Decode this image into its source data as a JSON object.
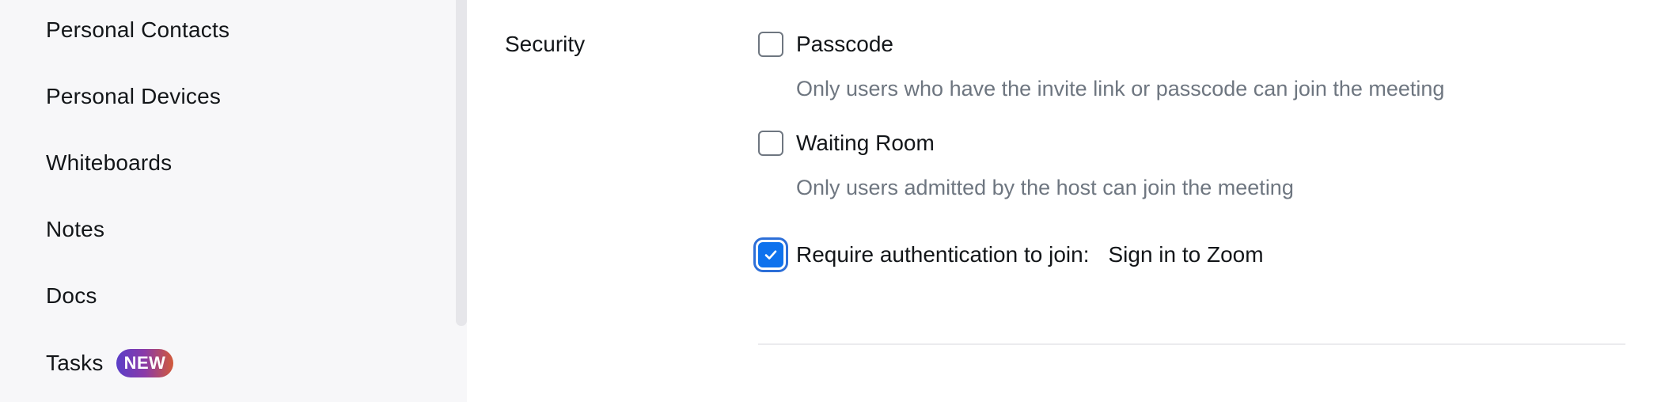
{
  "sidebar": {
    "items": [
      {
        "label": "Personal Contacts"
      },
      {
        "label": "Personal Devices"
      },
      {
        "label": "Whiteboards"
      },
      {
        "label": "Notes"
      },
      {
        "label": "Docs"
      },
      {
        "label": "Tasks",
        "badge": "NEW"
      }
    ]
  },
  "security": {
    "section_label": "Security",
    "options": [
      {
        "label": "Passcode",
        "checked": false,
        "description": "Only users who have the invite link or passcode can join the meeting"
      },
      {
        "label": "Waiting Room",
        "checked": false,
        "description": "Only users admitted by the host can join the meeting"
      },
      {
        "label": "Require authentication to join:",
        "checked": true,
        "value": "Sign in to Zoom"
      }
    ]
  },
  "colors": {
    "accent": "#0e72ed",
    "sidebar_bg": "#f7f7f9",
    "muted_text": "#6e7680"
  },
  "icons": {
    "checkmark": "check-icon"
  }
}
